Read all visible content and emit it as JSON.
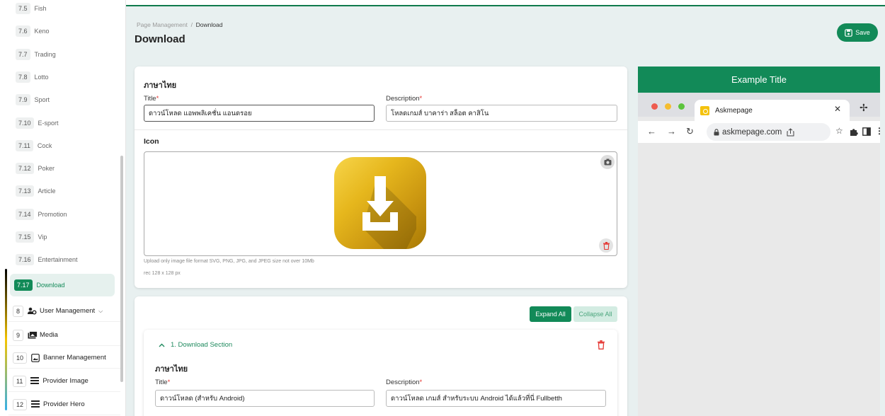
{
  "sidebar": {
    "sub_items": [
      {
        "num": "7.5",
        "label": "Fish"
      },
      {
        "num": "7.6",
        "label": "Keno"
      },
      {
        "num": "7.7",
        "label": "Trading"
      },
      {
        "num": "7.8",
        "label": "Lotto"
      },
      {
        "num": "7.9",
        "label": "Sport"
      },
      {
        "num": "7.10",
        "label": "E-sport"
      },
      {
        "num": "7.11",
        "label": "Cock"
      },
      {
        "num": "7.12",
        "label": "Poker"
      },
      {
        "num": "7.13",
        "label": "Article"
      },
      {
        "num": "7.14",
        "label": "Promotion"
      },
      {
        "num": "7.15",
        "label": "Vip"
      },
      {
        "num": "7.16",
        "label": "Entertainment"
      },
      {
        "num": "7.17",
        "label": "Download"
      }
    ],
    "main_items": [
      {
        "num": "8",
        "label": "User Management",
        "icon": "users-icon"
      },
      {
        "num": "9",
        "label": "Media",
        "icon": "media-icon"
      },
      {
        "num": "10",
        "label": "Banner Management",
        "icon": "banner-icon"
      },
      {
        "num": "11",
        "label": "Provider Image",
        "icon": "list-icon"
      },
      {
        "num": "12",
        "label": "Provider Hero",
        "icon": "list-icon"
      }
    ]
  },
  "header": {
    "breadcrumb_root": "Page Management",
    "breadcrumb_sep": "/",
    "breadcrumb_current": "Download",
    "title": "Download",
    "save_label": "Save"
  },
  "main_form": {
    "lang": "ภาษาไทย",
    "title_label": "Title",
    "title_value": "ดาวน์โหลด แอพพลิเคชั่น แอนดรอย",
    "desc_label": "Description",
    "desc_value": "โหลดเกมส์ บาคาร่า สล็อต คาสิโน",
    "required_mark": "*",
    "icon_label": "Icon",
    "upload_hint": "Upload only image file format SVG, PNG, JPG, and JPEG size not over 10Mb",
    "rec_hint": "rec 128 x 128 px"
  },
  "sections": {
    "expand_label": "Expand All",
    "collapse_label": "Collapse All",
    "first": {
      "heading": "1. Download Section",
      "lang": "ภาษาไทย",
      "title_label": "Title",
      "title_value": "ดาวน์โหลด (สำหรับ Android)",
      "desc_label": "Description",
      "desc_value": "ดาวน์โหลด เกมส์ สำหรับระบบ Android ได้แล้วที่นี่ Fullbetth"
    }
  },
  "preview": {
    "title": "Example Title",
    "tab_title": "Askmepage",
    "url": "askmepage.com"
  },
  "colors": {
    "accent": "#128a58",
    "danger": "#e53935"
  }
}
